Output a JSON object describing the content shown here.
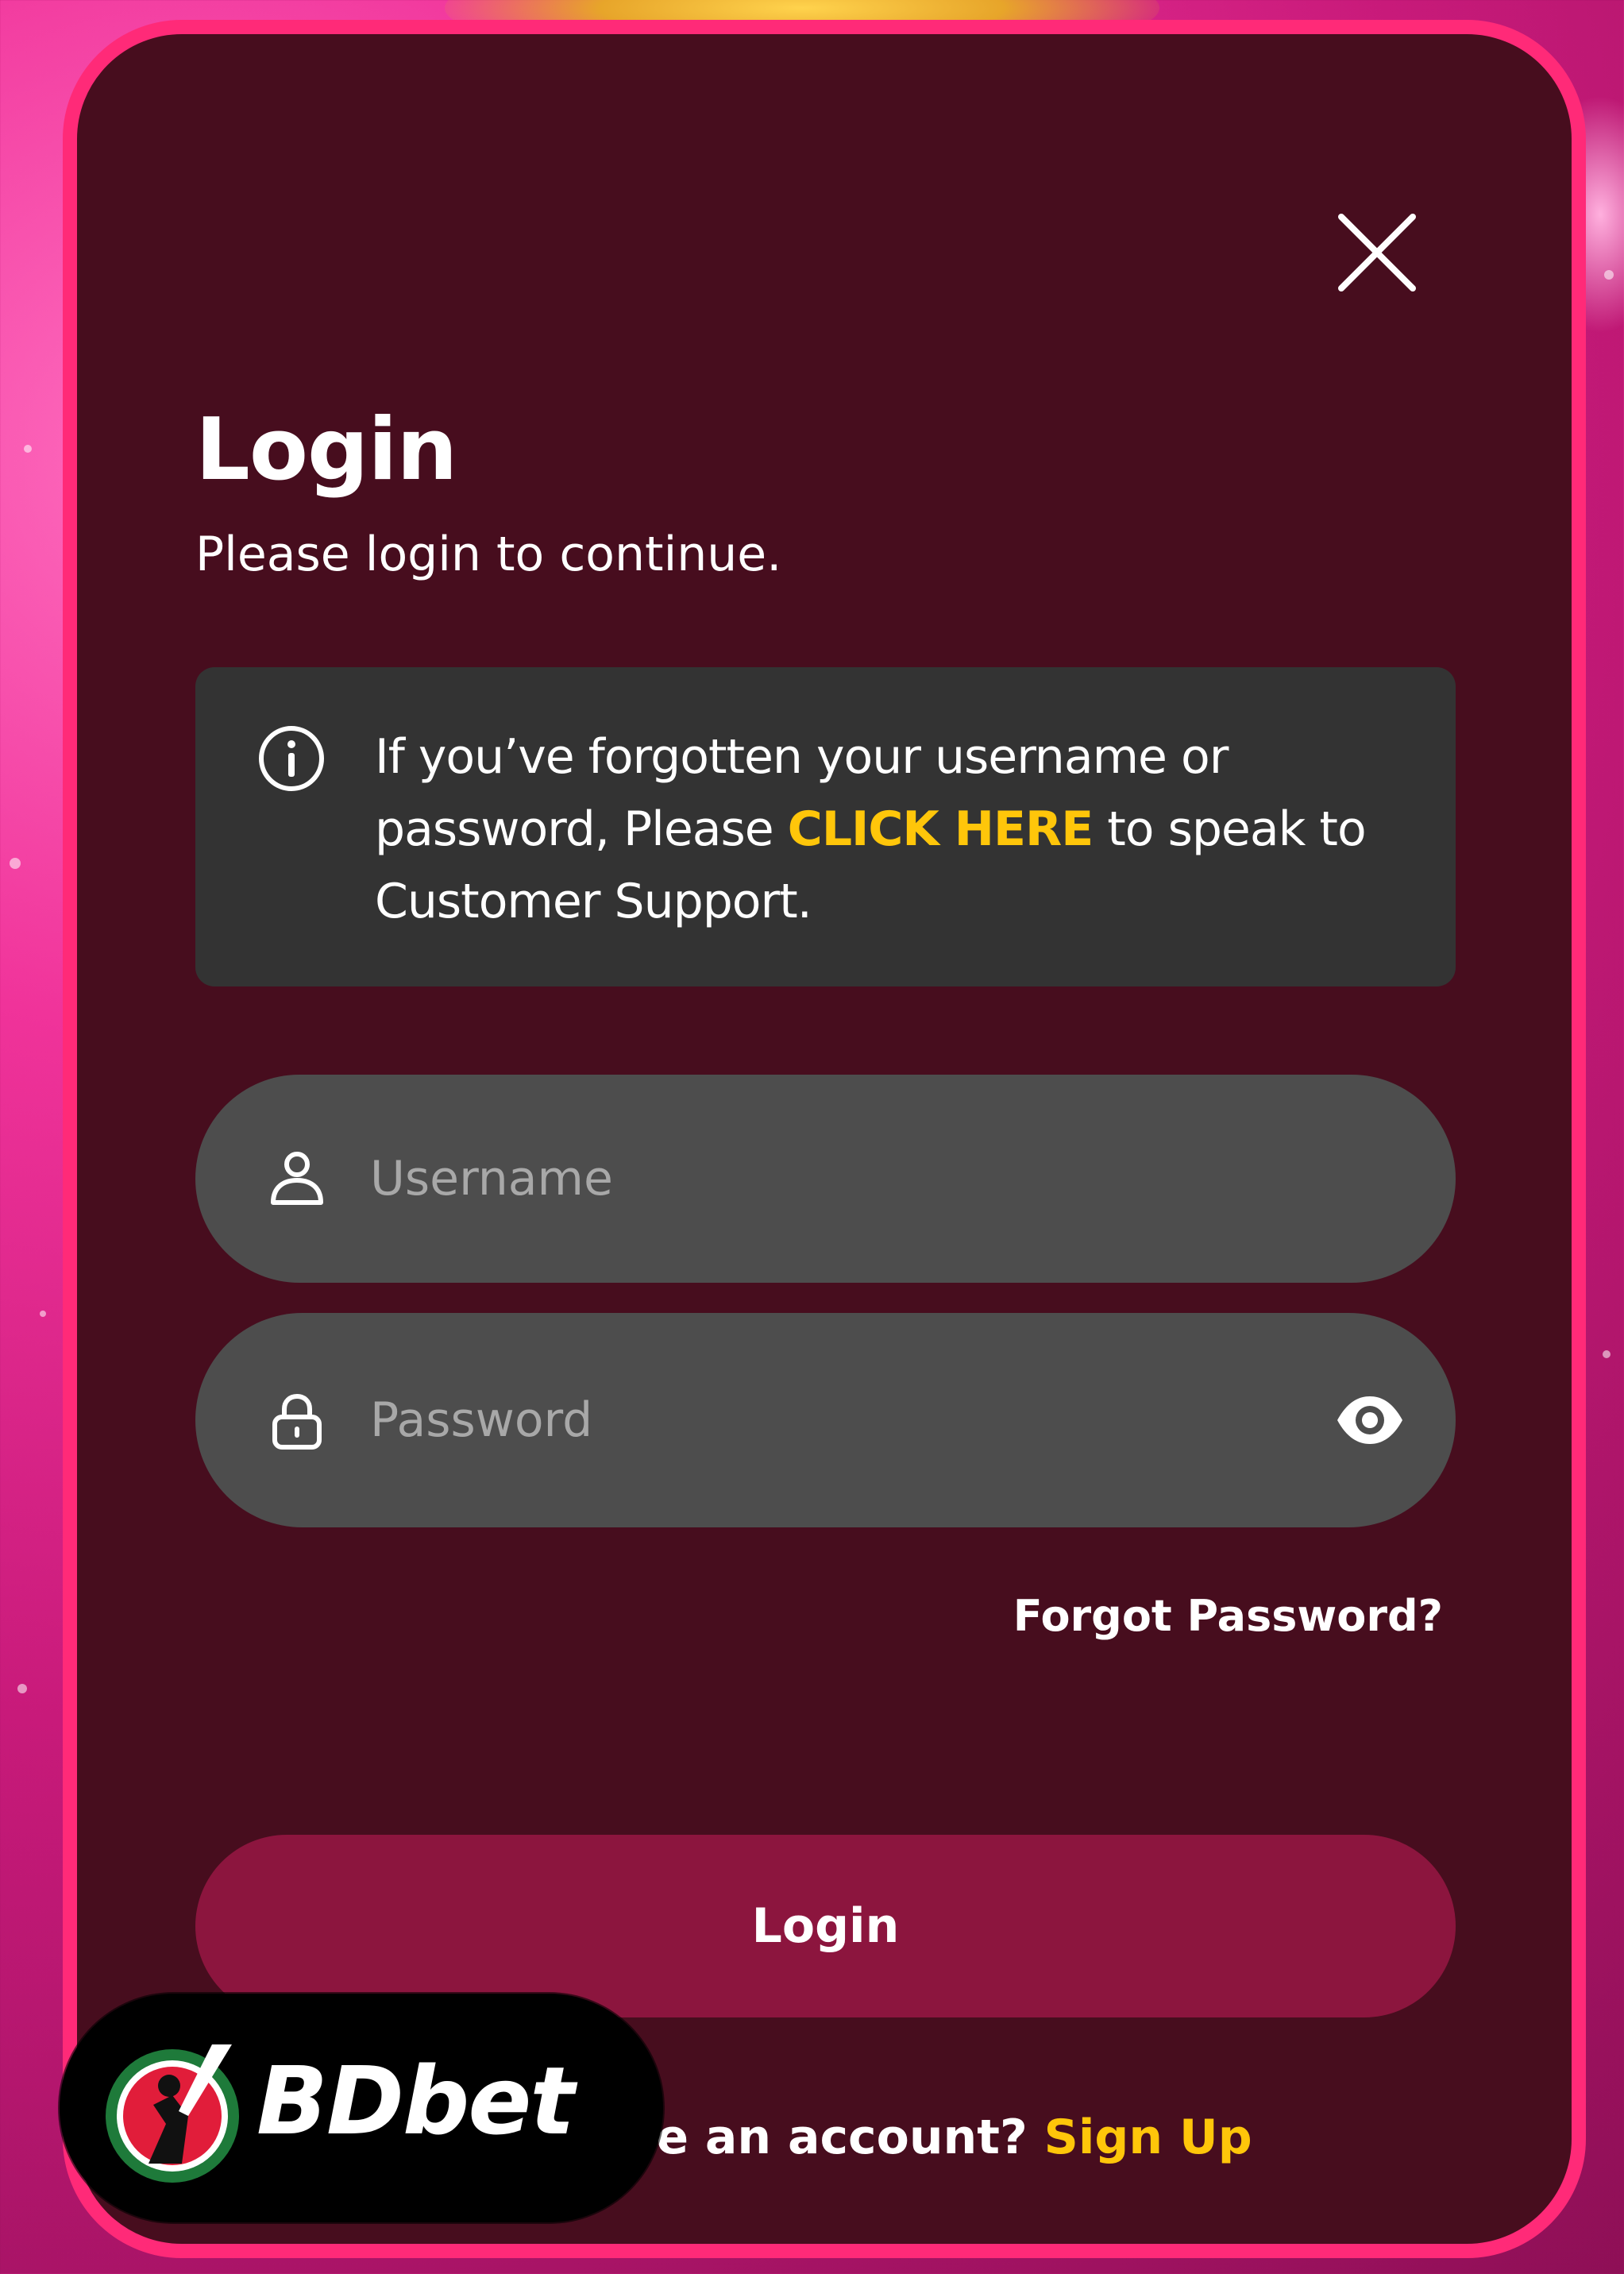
{
  "dialog": {
    "title": "Login",
    "subtitle": "Please login to continue."
  },
  "info_box": {
    "icon": "info-circle-icon",
    "text_before": "If you’ve forgotten your username or password, Please ",
    "link_text": "CLICK HERE",
    "text_after": " to speak to Customer Support."
  },
  "form": {
    "username": {
      "icon": "user-icon",
      "placeholder": "Username",
      "value": ""
    },
    "password": {
      "icon": "lock-icon",
      "placeholder": "Password",
      "value": "",
      "toggle_icon": "eye-icon"
    },
    "forgot_password_label": "Forgot Password?",
    "login_button_label": "Login"
  },
  "signup": {
    "prompt": "Don't have an account? ",
    "link_text": "Sign Up"
  },
  "brand": {
    "name": "BDbet",
    "logo_icon": "cricket-batsman-logo-icon"
  },
  "colors": {
    "accent_link": "#ffc60a",
    "modal_background": "#470d1e",
    "modal_border": "#ff2a78",
    "login_button": "#8c153e",
    "input_background": "#4d4d4d",
    "info_background": "#333333"
  }
}
